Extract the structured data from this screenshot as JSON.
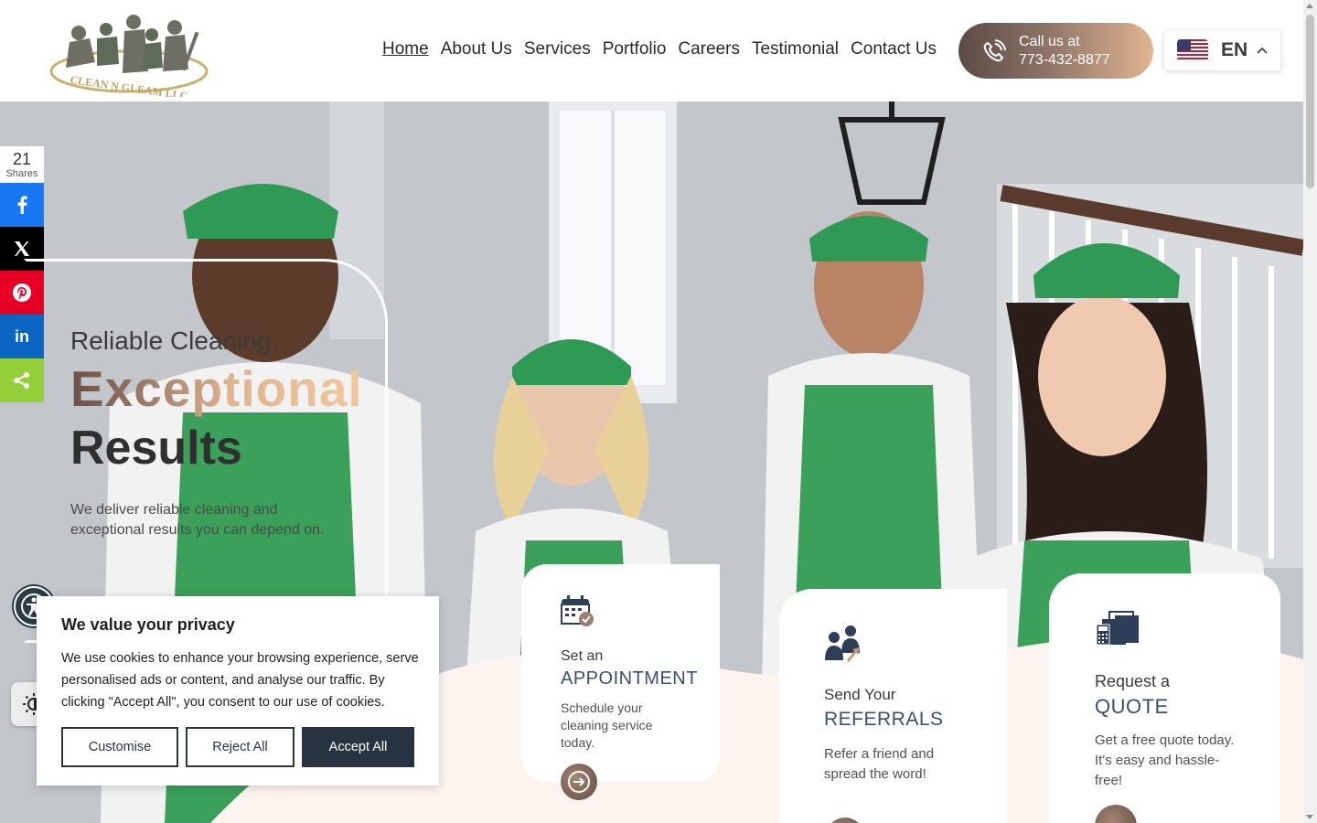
{
  "header": {
    "logo_text": "CLEAN N GLEAM LLC",
    "nav": [
      {
        "label": "Home",
        "active": true
      },
      {
        "label": "About Us"
      },
      {
        "label": "Services"
      },
      {
        "label": "Portfolio"
      },
      {
        "label": "Careers"
      },
      {
        "label": "Testimonial"
      },
      {
        "label": "Contact Us"
      }
    ],
    "call_line1": "Call us at",
    "call_line2": "773-432-8877",
    "language_code": "EN",
    "language_icon": "us-flag-icon"
  },
  "share": {
    "count": "21",
    "count_label": "Shares",
    "buttons": [
      {
        "name": "facebook",
        "glyph": "f",
        "color": "#1877f2"
      },
      {
        "name": "x",
        "glyph": "X",
        "color": "#000000"
      },
      {
        "name": "pinterest",
        "glyph": "P",
        "color": "#e60023"
      },
      {
        "name": "linkedin",
        "glyph": "in",
        "color": "#0a66c2"
      },
      {
        "name": "sharethis",
        "glyph": "<",
        "color": "#95d03a"
      }
    ]
  },
  "hero": {
    "line1": "Reliable Cleaning,",
    "line2": "Exceptional",
    "line3": "Results",
    "subtitle": "We deliver reliable cleaning and exceptional results you can depend on."
  },
  "features": [
    {
      "pre": "Set an",
      "title": "APPOINTMENT",
      "desc": "Schedule your cleaning service today.",
      "icon": "calendar-check-icon"
    },
    {
      "pre": "Send Your",
      "title": "REFERRALS",
      "desc": "Refer a friend and spread the word!",
      "icon": "people-referral-icon"
    },
    {
      "pre": "Request a",
      "title": "QUOTE",
      "desc": "Get a free quote today. It's easy and hassle-free!",
      "icon": "calculator-documents-icon"
    }
  ],
  "cookie": {
    "title": "We value your privacy",
    "body": "We use cookies to enhance your browsing experience, serve personalised ads or content, and analyse our traffic. By clicking \"Accept All\", you consent to our use of cookies.",
    "customise": "Customise",
    "reject": "Reject All",
    "accept": "Accept All"
  },
  "colors": {
    "accent_dark": "#283341",
    "brand_brown": "#6b5048",
    "brand_peach": "#e0b48e",
    "apron_green": "#3aa05a",
    "cap_green": "#2e9a55"
  }
}
